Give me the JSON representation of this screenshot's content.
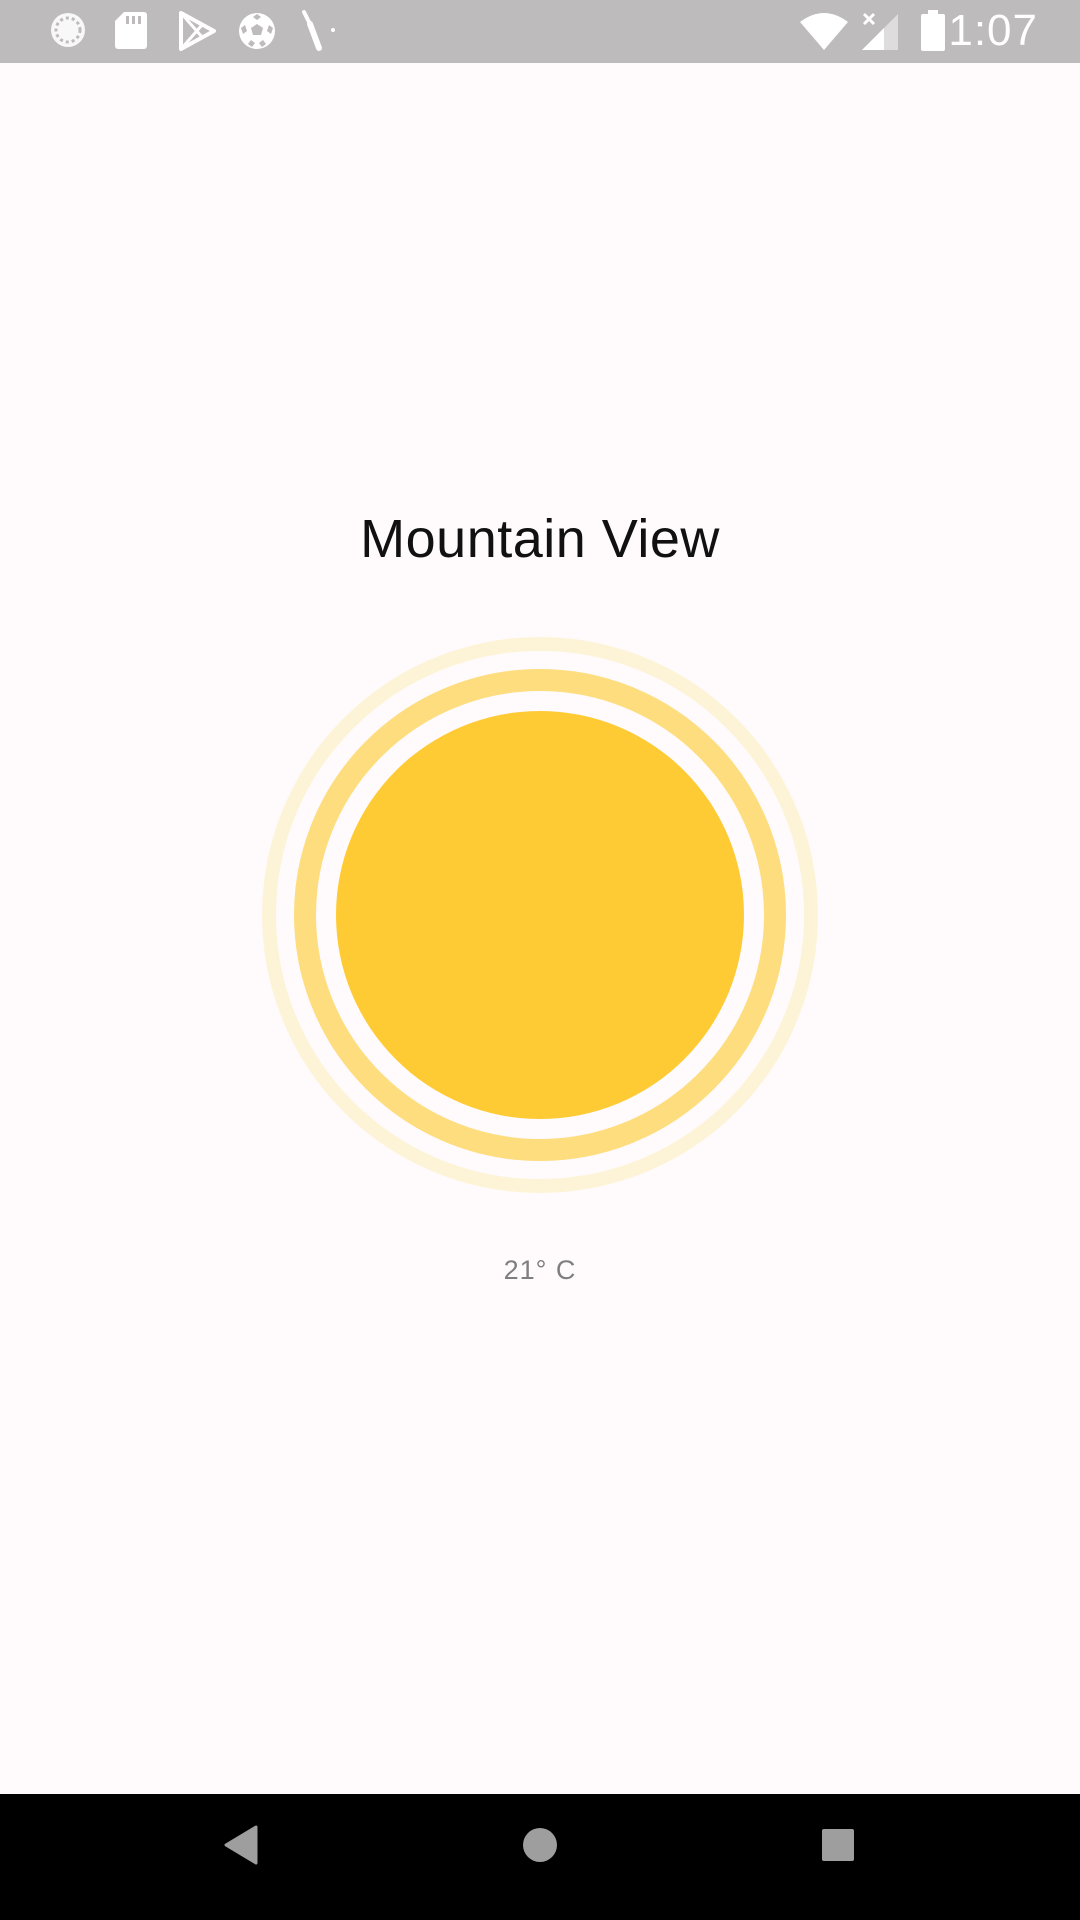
{
  "status_bar": {
    "time": "1:07",
    "left_icons": [
      "sync-icon",
      "sd-card-icon",
      "play-store-icon",
      "soccer-ball-icon",
      "screwdriver-icon"
    ],
    "right_icons": [
      "wifi-icon",
      "signal-no-service-icon",
      "battery-icon"
    ]
  },
  "weather": {
    "city": "Mountain View",
    "temperature": "21° C",
    "condition_icon": "sun-icon"
  },
  "colors": {
    "sun_core": "#fecb35",
    "sun_ring_mid": "#fedd7f",
    "sun_ring_outer": "#fdf4d8",
    "background": "#fffbfd",
    "status_bar": "#bdbbbc"
  },
  "nav_bar": {
    "buttons": [
      "back-icon",
      "home-icon",
      "recents-icon"
    ]
  }
}
